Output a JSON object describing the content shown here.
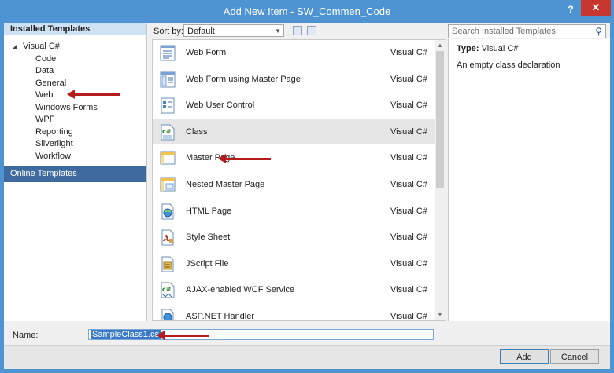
{
  "window": {
    "title": "Add New Item - SW_Commen_Code",
    "help": "?",
    "close": "✕"
  },
  "left_pane": {
    "header": "Installed Templates",
    "root": "Visual C#",
    "items": [
      "Code",
      "Data",
      "General",
      "Web",
      "Windows Forms",
      "WPF",
      "Reporting",
      "Silverlight",
      "Workflow"
    ],
    "online": "Online Templates"
  },
  "toolbar": {
    "sort_label": "Sort by:",
    "sort_value": "Default"
  },
  "templates": [
    {
      "name": "Web Form",
      "type": "Visual C#",
      "icon": "web-form-icon"
    },
    {
      "name": "Web Form using Master Page",
      "type": "Visual C#",
      "icon": "web-form-master-icon"
    },
    {
      "name": "Web User Control",
      "type": "Visual C#",
      "icon": "user-control-icon"
    },
    {
      "name": "Class",
      "type": "Visual C#",
      "icon": "csharp-class-icon"
    },
    {
      "name": "Master Page",
      "type": "Visual C#",
      "icon": "master-page-icon"
    },
    {
      "name": "Nested Master Page",
      "type": "Visual C#",
      "icon": "nested-master-page-icon"
    },
    {
      "name": "HTML Page",
      "type": "Visual C#",
      "icon": "html-page-icon"
    },
    {
      "name": "Style Sheet",
      "type": "Visual C#",
      "icon": "style-sheet-icon"
    },
    {
      "name": "JScript File",
      "type": "Visual C#",
      "icon": "jscript-file-icon"
    },
    {
      "name": "AJAX-enabled WCF Service",
      "type": "Visual C#",
      "icon": "wcf-service-icon"
    },
    {
      "name": "ASP.NET Handler",
      "type": "Visual C#",
      "icon": "aspnet-handler-icon"
    }
  ],
  "search": {
    "placeholder": "Search Installed Templates"
  },
  "details": {
    "type_label": "Type:",
    "type_value": "Visual C#",
    "description": "An empty class declaration"
  },
  "name_field": {
    "label": "Name:",
    "value": "SampleClass1.cs"
  },
  "buttons": {
    "add": "Add",
    "cancel": "Cancel"
  }
}
